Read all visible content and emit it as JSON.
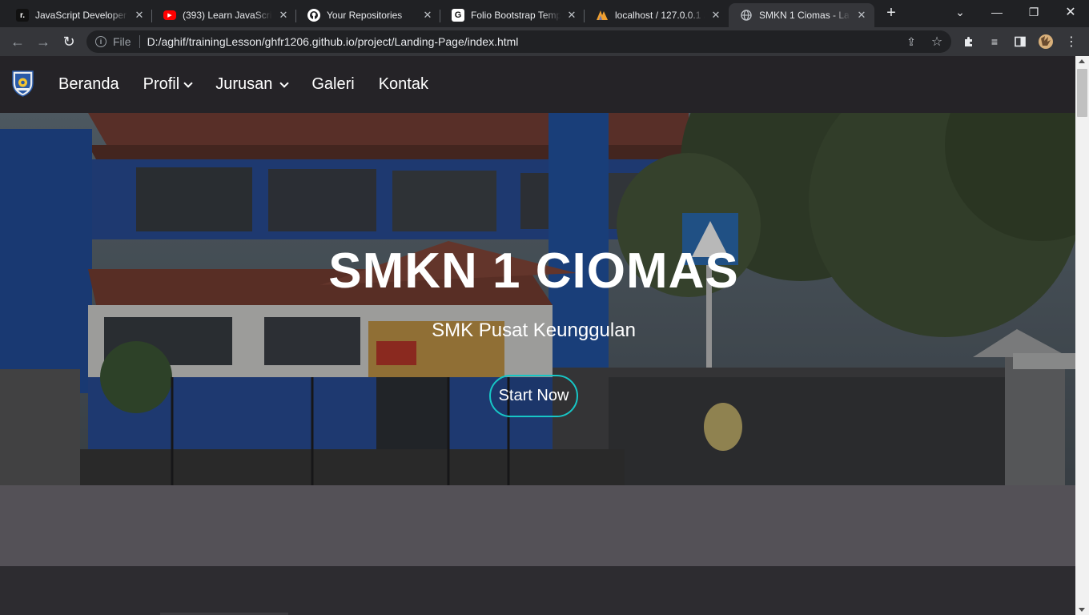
{
  "browser": {
    "tabs": [
      {
        "title": "JavaScript Developer (",
        "favicon": "r-icon",
        "favicon_color": "#ffffff",
        "active": false
      },
      {
        "title": "(393) Learn JavaScript",
        "favicon": "youtube-icon",
        "favicon_color": "#ff0000",
        "active": false
      },
      {
        "title": "Your Repositories",
        "favicon": "github-icon",
        "favicon_color": "#ffffff",
        "active": false
      },
      {
        "title": "Folio Bootstrap Templ",
        "favicon": "g-icon",
        "favicon_color": "#ffffff",
        "active": false
      },
      {
        "title": "localhost / 127.0.0.1 /",
        "favicon": "phpmyadmin-icon",
        "favicon_color": "#f0a030",
        "active": false
      },
      {
        "title": "SMKN 1 Ciomas - Lan",
        "favicon": "globe-icon",
        "favicon_color": "#bdc1c6",
        "active": true
      }
    ],
    "address": {
      "scheme_label": "File",
      "url": "D:/aghif/trainingLesson/ghfr1206.github.io/project/Landing-Page/index.html"
    }
  },
  "site": {
    "nav": {
      "items": [
        {
          "label": "Beranda",
          "dropdown": false
        },
        {
          "label": "Profil",
          "dropdown": true
        },
        {
          "label": "Jurusan",
          "dropdown": true
        },
        {
          "label": "Galeri",
          "dropdown": false
        },
        {
          "label": "Kontak",
          "dropdown": false
        }
      ]
    },
    "hero": {
      "title": "SMKN 1 CIOMAS",
      "subtitle": "SMK Pusat Keunggulan",
      "button_label": "Start Now"
    },
    "colors": {
      "nav_bg": "#252327",
      "accent": "#17c6c6",
      "band": "#545157",
      "page_bg": "#2d2c30"
    }
  }
}
